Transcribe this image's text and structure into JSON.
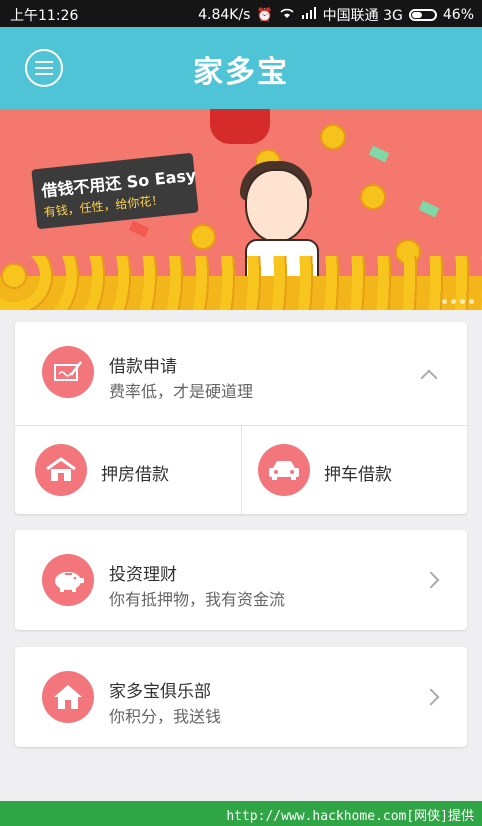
{
  "status_bar": {
    "time": "上午11:26",
    "net_speed": "4.84K/s",
    "carrier": "中国联通 3G",
    "battery": "46%"
  },
  "header": {
    "title": "家多宝",
    "menu_icon": "hamburger-menu-icon"
  },
  "banner": {
    "headline": "借钱不用还 So Easy",
    "subline": "有钱，任性，给你花！"
  },
  "cards": {
    "loan_apply": {
      "title": "借款申请",
      "subtitle": "费率低，才是硬道理",
      "icon": "pen-paper-icon",
      "chevron": "chevron-up-icon"
    },
    "house_loan": {
      "label": "押房借款",
      "icon": "house-icon"
    },
    "car_loan": {
      "label": "押车借款",
      "icon": "car-icon"
    },
    "invest": {
      "title": "投资理财",
      "subtitle": "你有抵押物，我有资金流",
      "icon": "piggy-bank-icon",
      "chevron": "chevron-right-icon"
    },
    "club": {
      "title": "家多宝俱乐部",
      "subtitle": "你积分，我送钱",
      "icon": "home-icon",
      "chevron": "chevron-right-icon"
    }
  },
  "footer": {
    "watermark": "http://www.hackhome.com[网侠]提供"
  },
  "colors": {
    "header_bg": "#4fc4d6",
    "icon_pink": "#f4767d",
    "banner_bg": "#f4786e",
    "footer_bg": "#2fa546"
  }
}
